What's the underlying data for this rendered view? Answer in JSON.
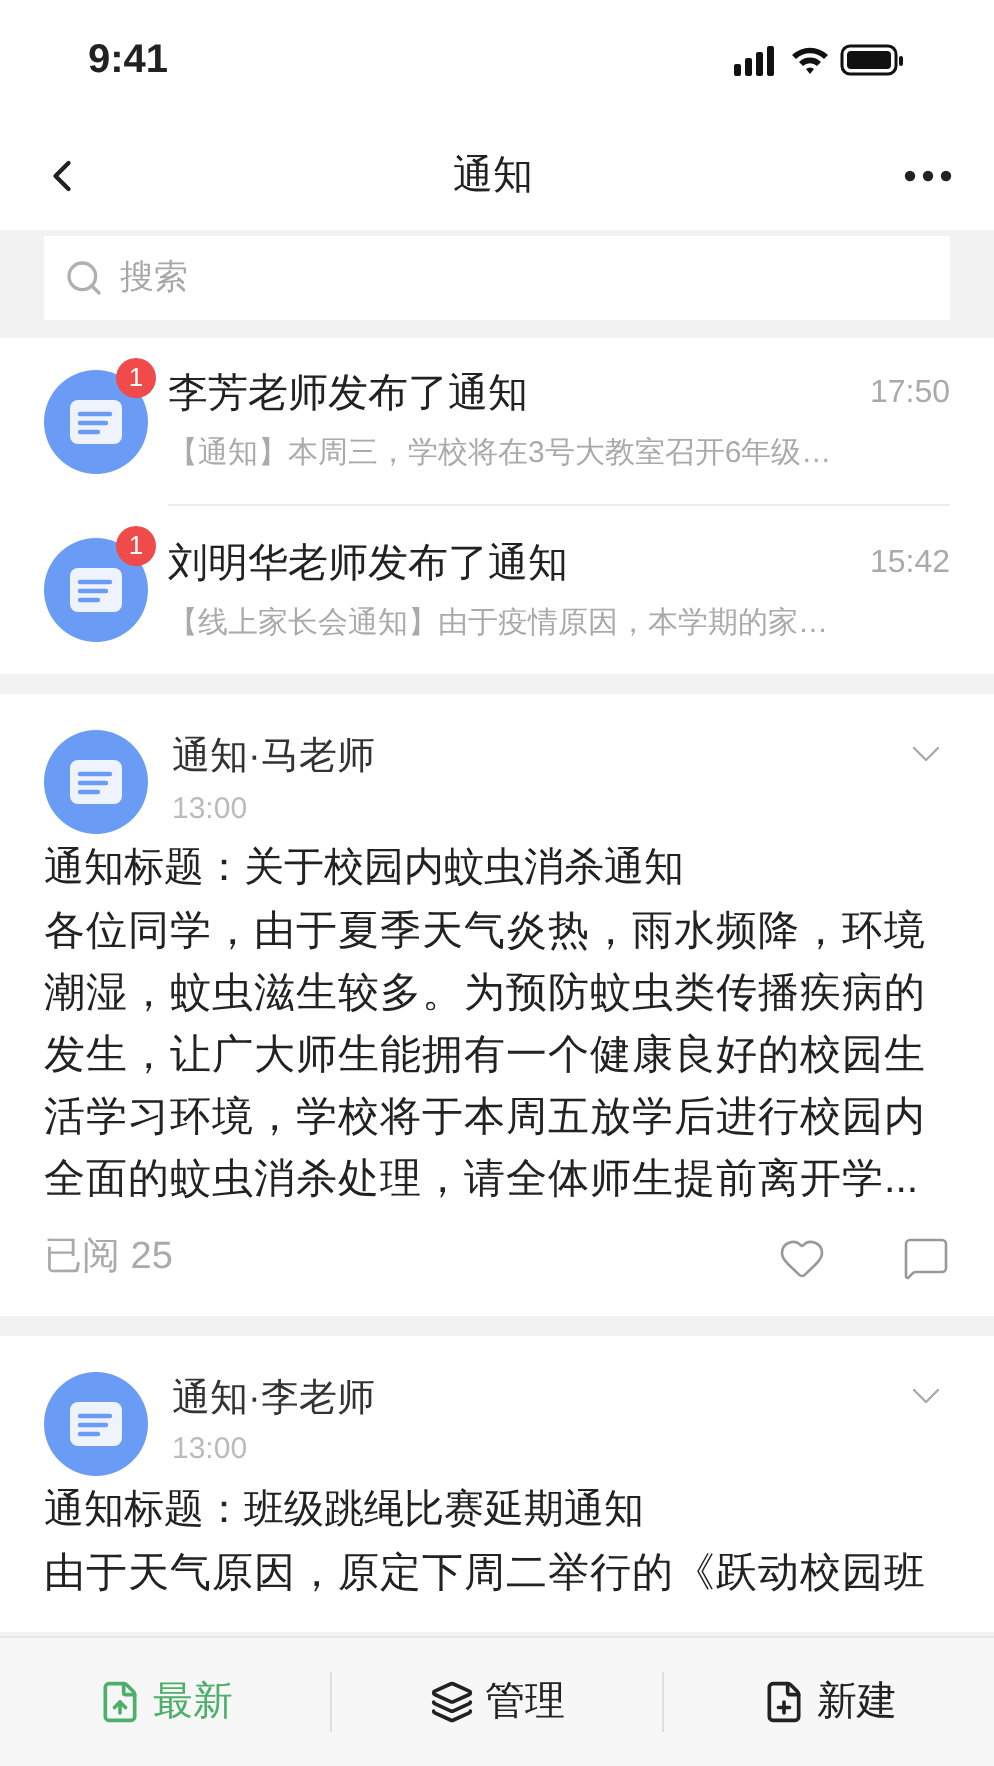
{
  "status_bar": {
    "time": "9:41"
  },
  "header": {
    "title": "通知"
  },
  "search": {
    "placeholder": "搜索"
  },
  "messages": [
    {
      "title": "李芳老师发布了通知",
      "time": "17:50",
      "preview": "【通知】本周三，学校将在3号大教室召开6年级…",
      "badge": "1"
    },
    {
      "title": "刘明华老师发布了通知",
      "time": "15:42",
      "preview": "【线上家长会通知】由于疫情原因，本学期的家…",
      "badge": "1"
    }
  ],
  "posts": [
    {
      "author": "通知·马老师",
      "time": "13:00",
      "subject": "通知标题：关于校园内蚊虫消杀通知",
      "body": "各位同学，由于夏季天气炎热，雨水频降，环境潮湿，蚊虫滋生较多。为预防蚊虫类传播疾病的发生，让广大师生能拥有一个健康良好的校园生活学习环境，学校将于本周五放学后进行校园内全面的蚊虫消杀处理，请全体师生提前离开学...",
      "read_count": "已阅 25"
    },
    {
      "author": "通知·李老师",
      "time": "13:00",
      "subject": "通知标题：班级跳绳比赛延期通知",
      "body": "由于天气原因，原定下周二举行的《跃动校园班"
    }
  ],
  "bottom_tabs": [
    {
      "label": "最新",
      "kind": "latest",
      "selected": true
    },
    {
      "label": "管理",
      "kind": "manage",
      "selected": false
    },
    {
      "label": "新建",
      "kind": "new",
      "selected": false
    }
  ]
}
